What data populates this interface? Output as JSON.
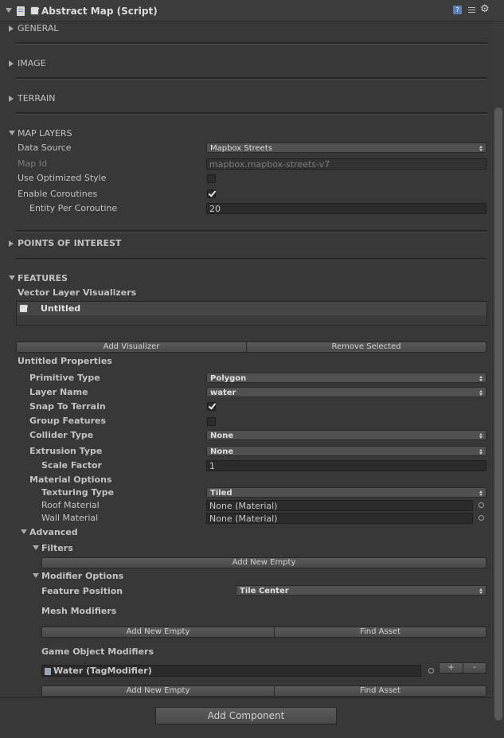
{
  "header": {
    "title": "Abstract Map (Script)",
    "script_icon": "script-file-icon",
    "help_icon": "help-book-icon",
    "presets_icon": "presets-icon",
    "gear_icon": "gear-icon"
  },
  "sections": {
    "general": "GENERAL",
    "image": "IMAGE",
    "terrain": "TERRAIN",
    "map_layers": "MAP LAYERS",
    "poi": "POINTS OF INTEREST",
    "features": "FEATURES"
  },
  "map_layers": {
    "data_source_label": "Data Source",
    "data_source_value": "Mapbox Streets",
    "map_id_label": "Map Id",
    "map_id_value": "mapbox.mapbox-streets-v7",
    "optimized_label": "Use Optimized Style",
    "coroutines_label": "Enable Coroutines",
    "entity_label": "Entity Per Coroutine",
    "entity_value": "20"
  },
  "features": {
    "visualizers_label": "Vector Layer Visualizers",
    "list_item": "Untitled",
    "add_visualizer": "Add Visualizer",
    "remove_selected": "Remove Selected",
    "properties_title": "Untitled Properties",
    "primitive_label": "Primitive Type",
    "primitive_value": "Polygon",
    "layer_label": "Layer Name",
    "layer_value": "water",
    "snap_label": "Snap To Terrain",
    "group_label": "Group Features",
    "collider_label": "Collider Type",
    "collider_value": "None",
    "extrusion_label": "Extrusion Type",
    "extrusion_value": "None",
    "scale_label": "Scale Factor",
    "scale_value": "1",
    "material_label": "Material Options",
    "texturing_label": "Texturing Type",
    "texturing_value": "Tiled",
    "roof_label": "Roof Material",
    "roof_value": "None (Material)",
    "wall_label": "Wall Material",
    "wall_value": "None (Material)"
  },
  "advanced": {
    "title": "Advanced",
    "filters": "Filters",
    "add_new_empty": "Add New Empty",
    "modifier_options": "Modifier Options",
    "feature_position_label": "Feature Position",
    "feature_position_value": "Tile Center",
    "mesh_modifiers": "Mesh Modifiers",
    "find_asset": "Find Asset",
    "go_modifiers": "Game Object Modifiers",
    "go_modifier_item": "Water (TagModifier)",
    "plus": "+",
    "minus": "-"
  },
  "footer": {
    "add_component": "Add Component"
  }
}
